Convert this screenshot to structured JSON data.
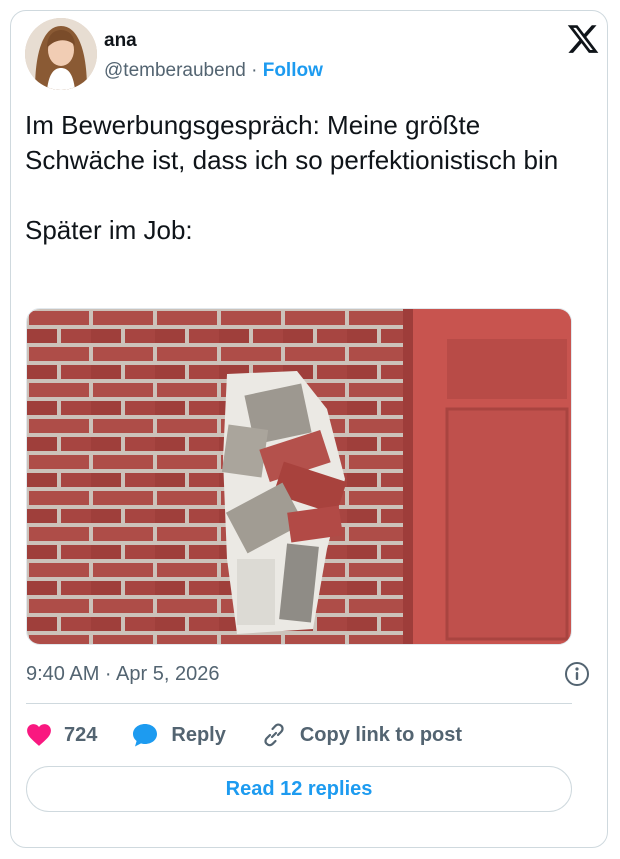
{
  "author": {
    "name": "ana",
    "handle": "@temberaubend",
    "separator": "·",
    "follow_label": "Follow"
  },
  "logo": "x-logo-icon",
  "tweet": {
    "text": "Im Bewerbungsgespräch: Meine größte Schwäche ist, dass ich so perfektionistisch bin\n\nSpäter im Job:"
  },
  "timestamp": "9:40 AM · Apr 5, 2026",
  "actions": {
    "likes": "724",
    "reply_label": "Reply",
    "copy_label": "Copy link to post"
  },
  "read_replies_label": "Read 12 replies",
  "colors": {
    "accent": "#1d9bf0",
    "like": "#f91880",
    "muted": "#536471",
    "border": "#cfd9de"
  }
}
